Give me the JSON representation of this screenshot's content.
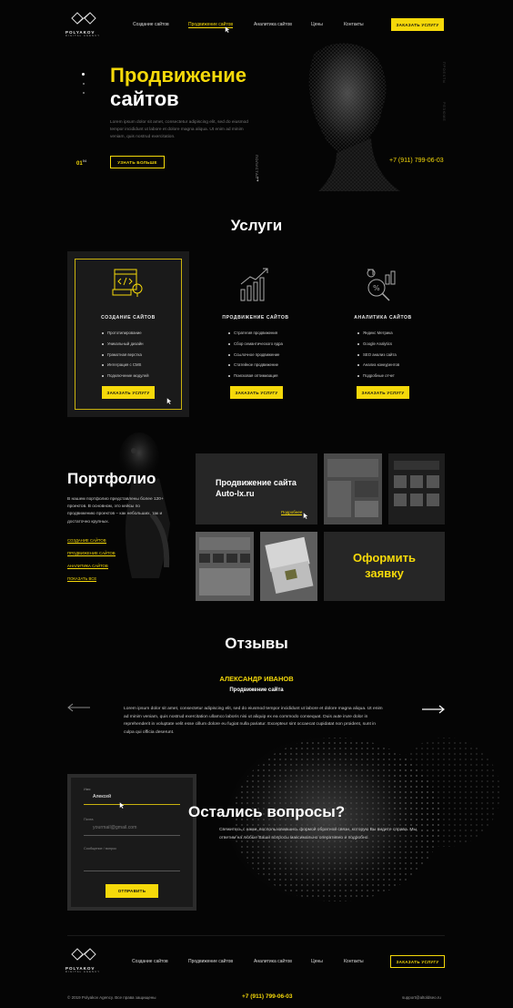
{
  "brand": {
    "name": "POLYAKOV",
    "tagline": "DIGITAL AGENCY"
  },
  "nav": {
    "items": [
      {
        "label": "Создание сайтов",
        "active": false
      },
      {
        "label": "Продвижение сайтов",
        "active": true
      },
      {
        "label": "Аналитика сайтов",
        "active": false
      },
      {
        "label": "Цены",
        "active": false
      },
      {
        "label": "Контакты",
        "active": false
      }
    ],
    "cta_label": "ЗАКАЗАТЬ УСЛУГУ"
  },
  "hero": {
    "title_line1": "Продвижение",
    "title_line2": "сайтов",
    "description": "Lorem ipsum dolor sit amet, consectetur adipiscing elit, sed do eiusmod tempor incididunt ut labore et dolore magna aliqua. Ut enim ad minim veniam, quis nostrud exercitation.",
    "slide_current": "01",
    "slide_total": "04",
    "more_button": "УЗНАТЬ БОЛЬШЕ",
    "scroll_label": "ПОЛИСТАЙ",
    "phone": "+7 (911) 799-06-03",
    "side_labels": [
      "ПРОЕКТЫ",
      "РЕЗЮМЕ"
    ]
  },
  "services": {
    "heading": "Услуги",
    "cards": [
      {
        "title": "СОЗДАНИЕ САЙТОВ",
        "icon": "web-design-icon",
        "items": [
          "Прототипирование",
          "Уникальный дизайн",
          "Грамотная верстка",
          "Интеграция с CMS",
          "Подключение модулей"
        ],
        "button": "ЗАКАЗАТЬ УСЛУГУ"
      },
      {
        "title": "ПРОДВИЖЕНИЕ САЙТОВ",
        "icon": "growth-chart-icon",
        "items": [
          "Стратегия продвижения",
          "Сбор семантического ядра",
          "Ссылочное продвижение",
          "Статейное продвижение",
          "Поисковая оптимизация"
        ],
        "button": "ЗАКАЗАТЬ УСЛУГУ"
      },
      {
        "title": "АНАЛИТИКА САЙТОВ",
        "icon": "analytics-icon",
        "items": [
          "Яндекс Метрика",
          "Google Analytics",
          "SEO анализ сайта",
          "Анализ конкурентов",
          "Подробные отчет"
        ],
        "button": "ЗАКАЗАТЬ УСЛУГУ"
      }
    ]
  },
  "portfolio": {
    "heading": "Портфолио",
    "description": "В нашем портфолио представлены более 120+ проектов. В основном, это кейсы по продвижению проектов – как небольших, так и достаточно крупных.",
    "links": [
      "СОЗДАНИЕ САЙТОВ",
      "ПРОДВИЖЕНИЕ САЙТОВ",
      "АНАЛИТИКА САЙТОВ",
      "ПОКАЗАТЬ ВСЕ"
    ],
    "featured_title_line1": "Продвижение сайта",
    "featured_title_line2": "Auto-lx.ru",
    "featured_more": "Подробнее",
    "cta_line1": "Оформить",
    "cta_line2": "заявку"
  },
  "reviews": {
    "heading": "Отзывы",
    "author": "АЛЕКСАНДР ИВАНОВ",
    "service": "Продвижение сайта",
    "text": "Lorem ipsum dolor sit amet, consectetur adipiscing elit, sed do eiusmod tempor incididunt ut labore et dolore magna aliqua. Ut enim ad minim veniam, quis nostrud exercitation ullamco laboris nisi ut aliquip ex ea commodo consequat. Duis aute irure dolor in reprehenderit in voluptate velit esse cillum dolore eu fugiat nulla pariatur. Excepteur sint occaecat cupidatat non proident, sunt in culpa qui officia deserunt."
  },
  "contact": {
    "name_label": "Имя",
    "name_value": "Алексей",
    "email_label": "Почта",
    "email_placeholder": "yourmail@gmail.com",
    "message_label": "Сообщение / вопрос",
    "submit": "ОТПРАВИТЬ",
    "heading": "Остались вопросы?",
    "text": "Свяжитесь с нами, воспользовавшись формой обратной связи, которую Вы видите справа. Мы ответим на любые Ваши вопросы максимально оперативно и подробно."
  },
  "footer": {
    "nav": [
      "Создание сайтов",
      "Продвижение сайтов",
      "Аналитика сайтов",
      "Цены",
      "Контакты"
    ],
    "cta_label": "ЗАКАЗАТЬ УСЛУГУ",
    "copyright": "© 2019 Polyakov Agency. Все права защищены",
    "phone": "+7 (911) 799-06-03",
    "email": "support@altoldseo.ru"
  },
  "colors": {
    "accent": "#f5d90a",
    "background": "#050505",
    "card": "#1a1a1a"
  }
}
